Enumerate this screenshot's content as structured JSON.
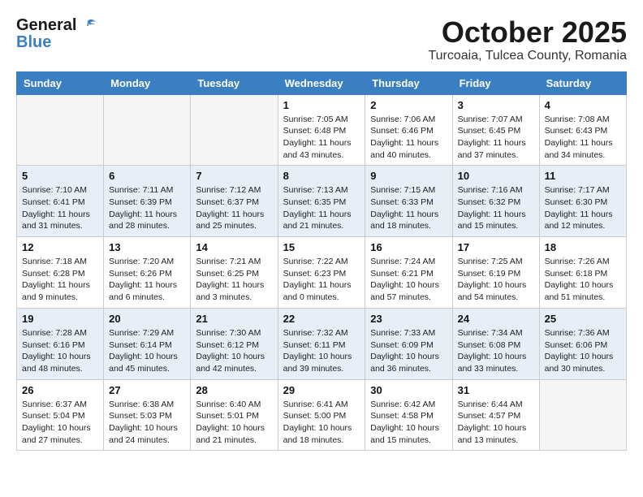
{
  "header": {
    "logo_general": "General",
    "logo_blue": "Blue",
    "month": "October 2025",
    "location": "Turcoaia, Tulcea County, Romania"
  },
  "days_of_week": [
    "Sunday",
    "Monday",
    "Tuesday",
    "Wednesday",
    "Thursday",
    "Friday",
    "Saturday"
  ],
  "weeks": [
    {
      "row_class": "row-odd",
      "days": [
        {
          "date": "",
          "info": "",
          "empty": true
        },
        {
          "date": "",
          "info": "",
          "empty": true
        },
        {
          "date": "",
          "info": "",
          "empty": true
        },
        {
          "date": "1",
          "info": "Sunrise: 7:05 AM\nSunset: 6:48 PM\nDaylight: 11 hours\nand 43 minutes.",
          "empty": false
        },
        {
          "date": "2",
          "info": "Sunrise: 7:06 AM\nSunset: 6:46 PM\nDaylight: 11 hours\nand 40 minutes.",
          "empty": false
        },
        {
          "date": "3",
          "info": "Sunrise: 7:07 AM\nSunset: 6:45 PM\nDaylight: 11 hours\nand 37 minutes.",
          "empty": false
        },
        {
          "date": "4",
          "info": "Sunrise: 7:08 AM\nSunset: 6:43 PM\nDaylight: 11 hours\nand 34 minutes.",
          "empty": false
        }
      ]
    },
    {
      "row_class": "row-even",
      "days": [
        {
          "date": "5",
          "info": "Sunrise: 7:10 AM\nSunset: 6:41 PM\nDaylight: 11 hours\nand 31 minutes.",
          "empty": false
        },
        {
          "date": "6",
          "info": "Sunrise: 7:11 AM\nSunset: 6:39 PM\nDaylight: 11 hours\nand 28 minutes.",
          "empty": false
        },
        {
          "date": "7",
          "info": "Sunrise: 7:12 AM\nSunset: 6:37 PM\nDaylight: 11 hours\nand 25 minutes.",
          "empty": false
        },
        {
          "date": "8",
          "info": "Sunrise: 7:13 AM\nSunset: 6:35 PM\nDaylight: 11 hours\nand 21 minutes.",
          "empty": false
        },
        {
          "date": "9",
          "info": "Sunrise: 7:15 AM\nSunset: 6:33 PM\nDaylight: 11 hours\nand 18 minutes.",
          "empty": false
        },
        {
          "date": "10",
          "info": "Sunrise: 7:16 AM\nSunset: 6:32 PM\nDaylight: 11 hours\nand 15 minutes.",
          "empty": false
        },
        {
          "date": "11",
          "info": "Sunrise: 7:17 AM\nSunset: 6:30 PM\nDaylight: 11 hours\nand 12 minutes.",
          "empty": false
        }
      ]
    },
    {
      "row_class": "row-odd",
      "days": [
        {
          "date": "12",
          "info": "Sunrise: 7:18 AM\nSunset: 6:28 PM\nDaylight: 11 hours\nand 9 minutes.",
          "empty": false
        },
        {
          "date": "13",
          "info": "Sunrise: 7:20 AM\nSunset: 6:26 PM\nDaylight: 11 hours\nand 6 minutes.",
          "empty": false
        },
        {
          "date": "14",
          "info": "Sunrise: 7:21 AM\nSunset: 6:25 PM\nDaylight: 11 hours\nand 3 minutes.",
          "empty": false
        },
        {
          "date": "15",
          "info": "Sunrise: 7:22 AM\nSunset: 6:23 PM\nDaylight: 11 hours\nand 0 minutes.",
          "empty": false
        },
        {
          "date": "16",
          "info": "Sunrise: 7:24 AM\nSunset: 6:21 PM\nDaylight: 10 hours\nand 57 minutes.",
          "empty": false
        },
        {
          "date": "17",
          "info": "Sunrise: 7:25 AM\nSunset: 6:19 PM\nDaylight: 10 hours\nand 54 minutes.",
          "empty": false
        },
        {
          "date": "18",
          "info": "Sunrise: 7:26 AM\nSunset: 6:18 PM\nDaylight: 10 hours\nand 51 minutes.",
          "empty": false
        }
      ]
    },
    {
      "row_class": "row-even",
      "days": [
        {
          "date": "19",
          "info": "Sunrise: 7:28 AM\nSunset: 6:16 PM\nDaylight: 10 hours\nand 48 minutes.",
          "empty": false
        },
        {
          "date": "20",
          "info": "Sunrise: 7:29 AM\nSunset: 6:14 PM\nDaylight: 10 hours\nand 45 minutes.",
          "empty": false
        },
        {
          "date": "21",
          "info": "Sunrise: 7:30 AM\nSunset: 6:12 PM\nDaylight: 10 hours\nand 42 minutes.",
          "empty": false
        },
        {
          "date": "22",
          "info": "Sunrise: 7:32 AM\nSunset: 6:11 PM\nDaylight: 10 hours\nand 39 minutes.",
          "empty": false
        },
        {
          "date": "23",
          "info": "Sunrise: 7:33 AM\nSunset: 6:09 PM\nDaylight: 10 hours\nand 36 minutes.",
          "empty": false
        },
        {
          "date": "24",
          "info": "Sunrise: 7:34 AM\nSunset: 6:08 PM\nDaylight: 10 hours\nand 33 minutes.",
          "empty": false
        },
        {
          "date": "25",
          "info": "Sunrise: 7:36 AM\nSunset: 6:06 PM\nDaylight: 10 hours\nand 30 minutes.",
          "empty": false
        }
      ]
    },
    {
      "row_class": "row-odd",
      "days": [
        {
          "date": "26",
          "info": "Sunrise: 6:37 AM\nSunset: 5:04 PM\nDaylight: 10 hours\nand 27 minutes.",
          "empty": false
        },
        {
          "date": "27",
          "info": "Sunrise: 6:38 AM\nSunset: 5:03 PM\nDaylight: 10 hours\nand 24 minutes.",
          "empty": false
        },
        {
          "date": "28",
          "info": "Sunrise: 6:40 AM\nSunset: 5:01 PM\nDaylight: 10 hours\nand 21 minutes.",
          "empty": false
        },
        {
          "date": "29",
          "info": "Sunrise: 6:41 AM\nSunset: 5:00 PM\nDaylight: 10 hours\nand 18 minutes.",
          "empty": false
        },
        {
          "date": "30",
          "info": "Sunrise: 6:42 AM\nSunset: 4:58 PM\nDaylight: 10 hours\nand 15 minutes.",
          "empty": false
        },
        {
          "date": "31",
          "info": "Sunrise: 6:44 AM\nSunset: 4:57 PM\nDaylight: 10 hours\nand 13 minutes.",
          "empty": false
        },
        {
          "date": "",
          "info": "",
          "empty": true
        }
      ]
    }
  ]
}
